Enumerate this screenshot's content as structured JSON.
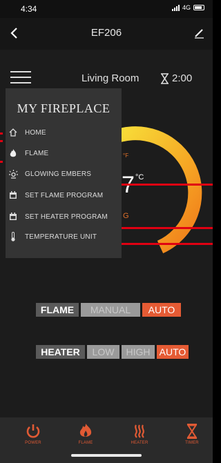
{
  "status_bar": {
    "time": "4:34",
    "network": "4G"
  },
  "nav": {
    "title": "EF206"
  },
  "subheader": {
    "room": "Living Room",
    "timer": "2:00"
  },
  "gauge": {
    "unit": "°C",
    "value_partial": "7",
    "small_label": "°F",
    "state_partial": "G"
  },
  "menu": {
    "title": "MY FIREPLACE",
    "items": [
      {
        "label": "HOME",
        "icon": "home-icon"
      },
      {
        "label": "FLAME",
        "icon": "flame-icon"
      },
      {
        "label": "GLOWING EMBERS",
        "icon": "embers-icon"
      },
      {
        "label": "SET FLAME PROGRAM",
        "icon": "calendar-icon"
      },
      {
        "label": "SET HEATER PROGRAM",
        "icon": "calendar-icon"
      },
      {
        "label": "TEMPERATURE UNIT",
        "icon": "thermometer-icon"
      }
    ]
  },
  "flame_control": {
    "label": "FLAME",
    "options": [
      "MANUAL",
      "AUTO"
    ],
    "selected": "AUTO"
  },
  "heater_control": {
    "label": "HEATER",
    "options": [
      "LOW",
      "HIGH",
      "AUTO"
    ],
    "selected": "AUTO"
  },
  "tabs": [
    {
      "label": "POWER",
      "icon": "power-icon"
    },
    {
      "label": "FLAME",
      "icon": "flame-icon"
    },
    {
      "label": "HEATER",
      "icon": "heater-icon"
    },
    {
      "label": "TIMER",
      "icon": "hourglass-icon"
    }
  ],
  "colors": {
    "accent": "#e55b34",
    "annotation": "#e00012",
    "gauge_start": "#f7e13a",
    "gauge_end": "#f07a1a"
  }
}
